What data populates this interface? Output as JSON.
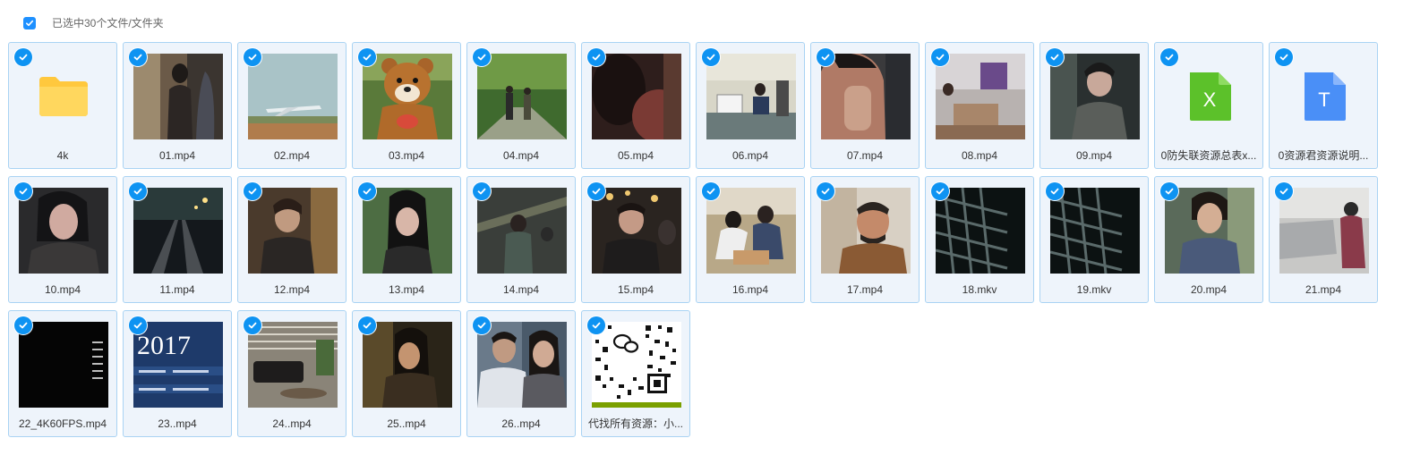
{
  "header": {
    "select_all_icon": "checkbox-checked-icon",
    "selection_text": "已选中30个文件/文件夹"
  },
  "colors": {
    "accent": "#0e93f2",
    "card_bg": "#eef4fb",
    "card_border": "#a9d3f3"
  },
  "files": [
    {
      "name": "4k",
      "kind": "folder"
    },
    {
      "name": "01.mp4",
      "kind": "video"
    },
    {
      "name": "02.mp4",
      "kind": "video"
    },
    {
      "name": "03.mp4",
      "kind": "video"
    },
    {
      "name": "04.mp4",
      "kind": "video"
    },
    {
      "name": "05.mp4",
      "kind": "video"
    },
    {
      "name": "06.mp4",
      "kind": "video"
    },
    {
      "name": "07.mp4",
      "kind": "video"
    },
    {
      "name": "08.mp4",
      "kind": "video"
    },
    {
      "name": "09.mp4",
      "kind": "video"
    },
    {
      "name": "0防失联资源总表x...",
      "kind": "excel"
    },
    {
      "name": "0资源君资源说明...",
      "kind": "document"
    },
    {
      "name": "10.mp4",
      "kind": "video"
    },
    {
      "name": "11.mp4",
      "kind": "video"
    },
    {
      "name": "12.mp4",
      "kind": "video"
    },
    {
      "name": "13.mp4",
      "kind": "video"
    },
    {
      "name": "14.mp4",
      "kind": "video"
    },
    {
      "name": "15.mp4",
      "kind": "video"
    },
    {
      "name": "16.mp4",
      "kind": "video"
    },
    {
      "name": "17.mp4",
      "kind": "video"
    },
    {
      "name": "18.mkv",
      "kind": "video"
    },
    {
      "name": "19.mkv",
      "kind": "video"
    },
    {
      "name": "20.mp4",
      "kind": "video"
    },
    {
      "name": "21.mp4",
      "kind": "video"
    },
    {
      "name": "22_4K60FPS.mp4",
      "kind": "video"
    },
    {
      "name": "23..mp4",
      "kind": "video"
    },
    {
      "name": "24..mp4",
      "kind": "video"
    },
    {
      "name": "25..mp4",
      "kind": "video"
    },
    {
      "name": "26..mp4",
      "kind": "video"
    },
    {
      "name": "代找所有资源：小...",
      "kind": "image"
    }
  ],
  "thumb_texts": {
    "excel_glyph": "X",
    "doc_glyph": "T",
    "year_text": "2017"
  }
}
